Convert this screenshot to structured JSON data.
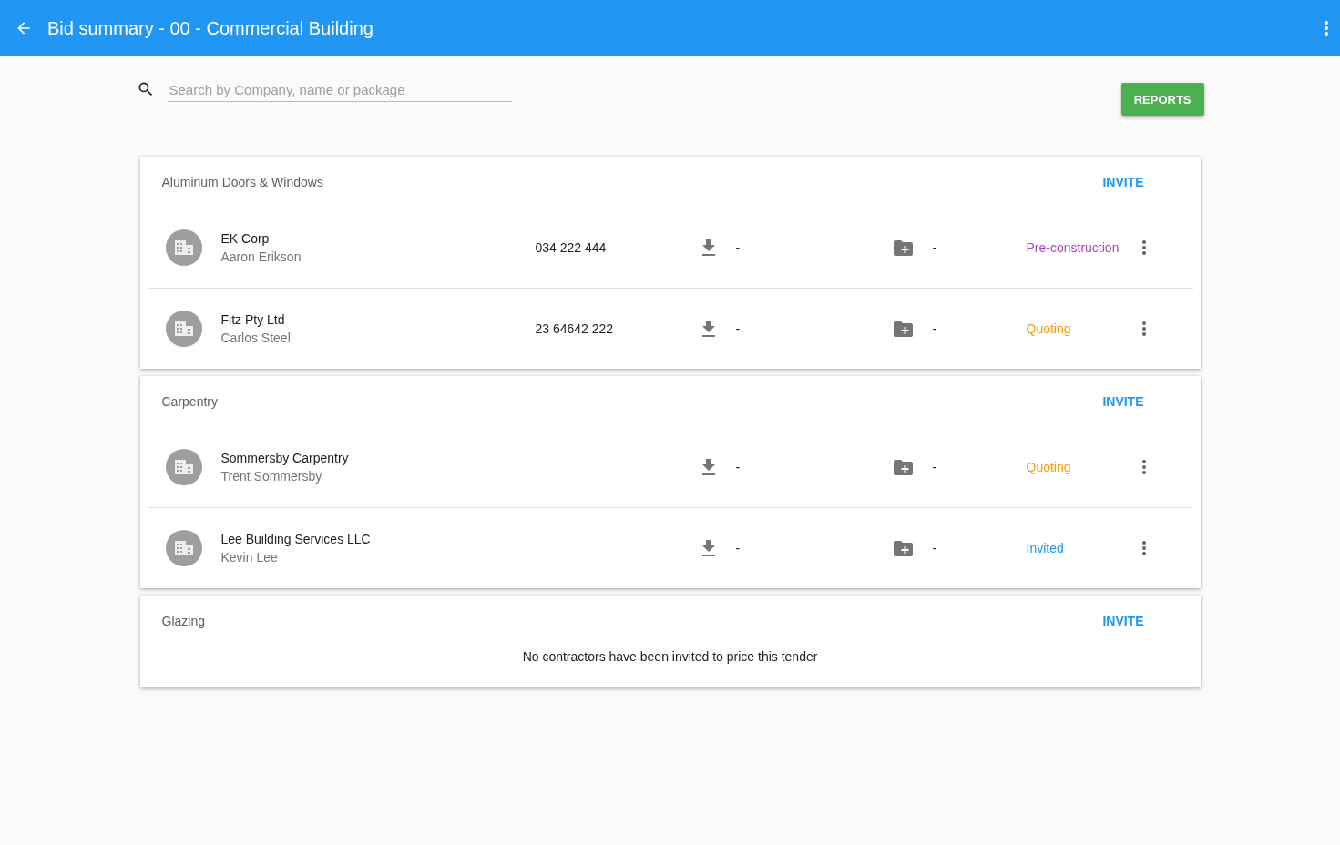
{
  "app_bar": {
    "title": "Bid summary - 00 - Commercial Building"
  },
  "search": {
    "placeholder": "Search by Company, name or package"
  },
  "reports_button": "REPORTS",
  "packages": [
    {
      "name": "Aluminum Doors & Windows",
      "invite": "INVITE",
      "bids": [
        {
          "company": "EK Corp",
          "contact": "Aaron Erikson",
          "phone": "034 222 444",
          "download": "-",
          "documents": "-",
          "status": "Pre-construction",
          "color": "#ab47bc"
        },
        {
          "company": "Fitz Pty Ltd",
          "contact": "Carlos Steel",
          "phone": "23 64642 222",
          "download": "-",
          "documents": "-",
          "status": "Quoting",
          "color": "#ff9800"
        }
      ]
    },
    {
      "name": "Carpentry",
      "invite": "INVITE",
      "bids": [
        {
          "company": "Sommersby Carpentry",
          "contact": "Trent Sommersby",
          "download": "-",
          "documents": "-",
          "status": "Quoting",
          "color": "#ff9800"
        },
        {
          "company": "Lee Building Services LLC",
          "contact": "Kevin Lee",
          "download": "-",
          "documents": "-",
          "status": "Invited",
          "color": "#2196f3"
        }
      ]
    },
    {
      "name": "Glazing",
      "invite": "INVITE",
      "empty_message": "No contractors have been invited to price this tender"
    }
  ]
}
